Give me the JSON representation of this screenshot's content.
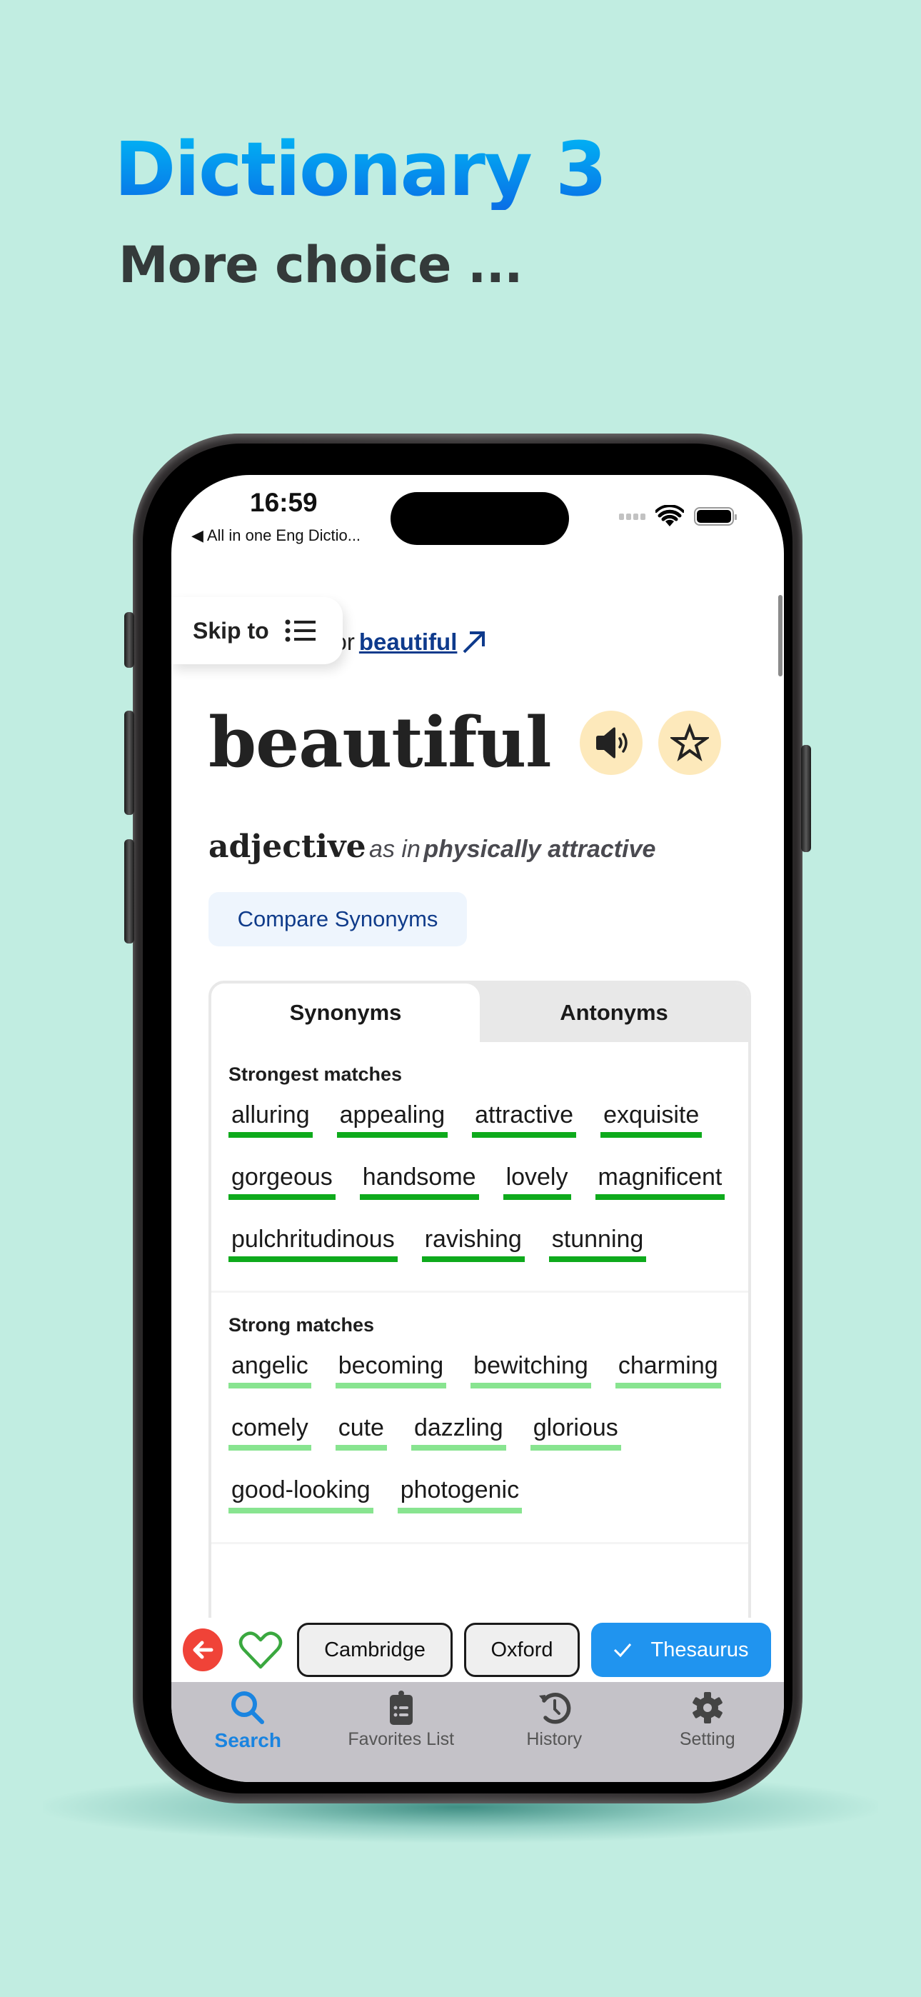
{
  "promo": {
    "title": "Dictionary 3",
    "subtitle": "More choice ..."
  },
  "status_bar": {
    "time": "16:59",
    "back_label": "◀ All in one Eng Dictio..."
  },
  "skip_to": {
    "label": "Skip to"
  },
  "synonyms_for": {
    "prefix": "ons for",
    "word": "beautiful"
  },
  "entry": {
    "headword": "beautiful",
    "part_of_speech": "adjective",
    "as_in_prefix": "as in",
    "as_in_sense": "physically attractive",
    "compare_label": "Compare Synonyms"
  },
  "tabs": [
    {
      "label": "Synonyms",
      "active": true
    },
    {
      "label": "Antonyms",
      "active": false
    }
  ],
  "sections": [
    {
      "title": "Strongest matches",
      "strength": "strongest",
      "words": [
        "alluring",
        "appealing",
        "attractive",
        "exquisite",
        "gorgeous",
        "handsome",
        "lovely",
        "magnificent",
        "pulchritudinous",
        "ravishing",
        "stunning"
      ]
    },
    {
      "title": "Strong matches",
      "strength": "strong",
      "words": [
        "angelic",
        "becoming",
        "bewitching",
        "charming",
        "comely",
        "cute",
        "dazzling",
        "glorious",
        "good-looking",
        "photogenic"
      ]
    }
  ],
  "source_bar": {
    "cambridge": "Cambridge",
    "oxford": "Oxford",
    "thesaurus": "Thesaurus",
    "selected": "Thesaurus"
  },
  "tabbar": [
    {
      "label": "Search",
      "icon": "search-icon",
      "active": true
    },
    {
      "label": "Favorites List",
      "icon": "clipboard-list-icon",
      "active": false
    },
    {
      "label": "History",
      "icon": "history-icon",
      "active": false
    },
    {
      "label": "Setting",
      "icon": "gear-icon",
      "active": false
    }
  ],
  "colors": {
    "background": "#c1ede1",
    "accent_blue": "#2094ef",
    "strongest_underline": "#0eaa1c",
    "strong_underline": "#88e490",
    "icon_button_bg": "#fde9bb",
    "back_button": "#f04338",
    "link_blue": "#0e3a8c"
  }
}
